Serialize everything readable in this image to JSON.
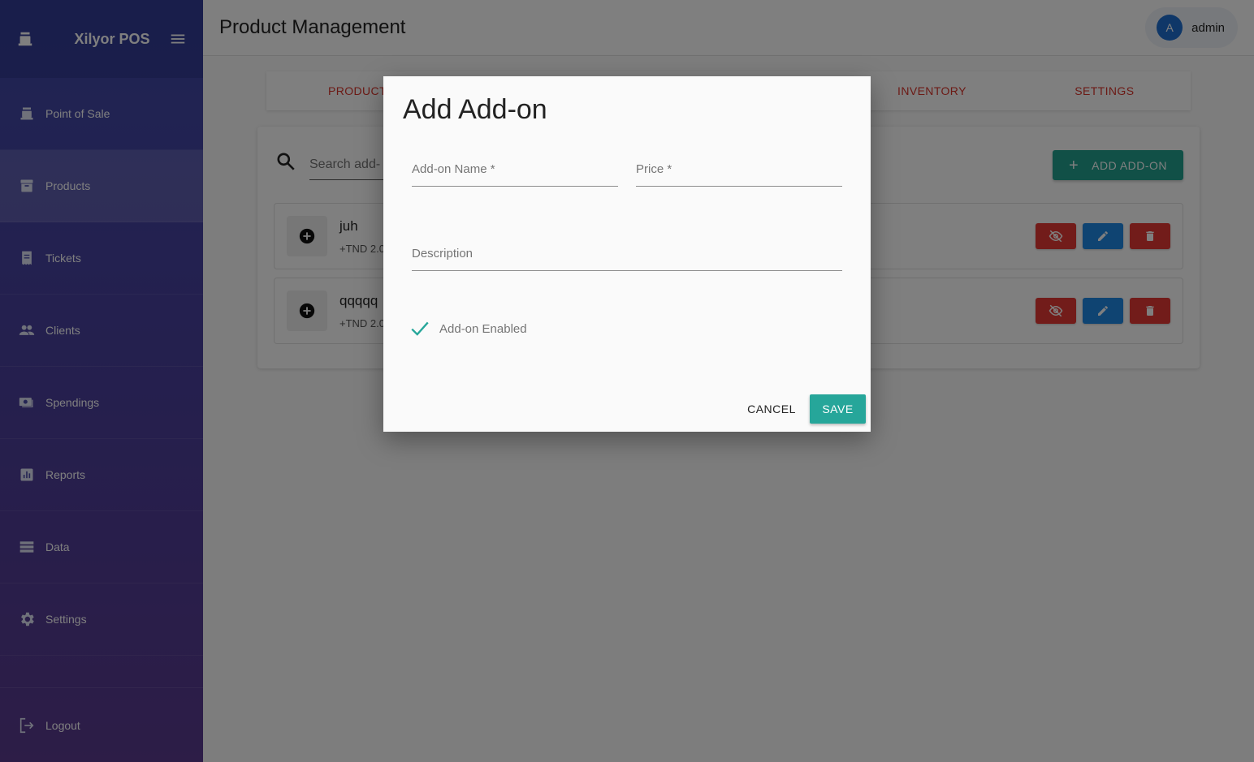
{
  "app": {
    "name": "Xilyor POS"
  },
  "sidebar": {
    "items": [
      {
        "label": "Point of Sale",
        "icon": "cash-register-icon"
      },
      {
        "label": "Products",
        "icon": "archive-box-icon",
        "active": true
      },
      {
        "label": "Tickets",
        "icon": "receipt-icon"
      },
      {
        "label": "Clients",
        "icon": "people-icon"
      },
      {
        "label": "Spendings",
        "icon": "money-icon"
      },
      {
        "label": "Reports",
        "icon": "bar-chart-icon"
      },
      {
        "label": "Data",
        "icon": "storage-icon"
      },
      {
        "label": "Settings",
        "icon": "gear-icon"
      }
    ],
    "logout": "Logout"
  },
  "header": {
    "title": "Product Management",
    "user": {
      "initial": "A",
      "name": "admin"
    }
  },
  "tabs": [
    "PRODUCT",
    "INVENTORY",
    "SETTINGS"
  ],
  "toolbar": {
    "search_placeholder": "Search add-",
    "add_label": "ADD ADD-ON"
  },
  "addons": [
    {
      "name": "juh",
      "price": "+TND 2.0"
    },
    {
      "name": "qqqqq",
      "price": "+TND 2.0"
    }
  ],
  "dialog": {
    "title": "Add Add-on",
    "name_label": "Add-on Name *",
    "price_label": "Price *",
    "description_label": "Description",
    "enabled_label": "Add-on Enabled",
    "enabled": true,
    "cancel_label": "CANCEL",
    "save_label": "SAVE"
  },
  "colors": {
    "accent": "#26a69a",
    "danger": "#e53935",
    "primary": "#1e88e5",
    "tab_text": "#d9342b"
  }
}
